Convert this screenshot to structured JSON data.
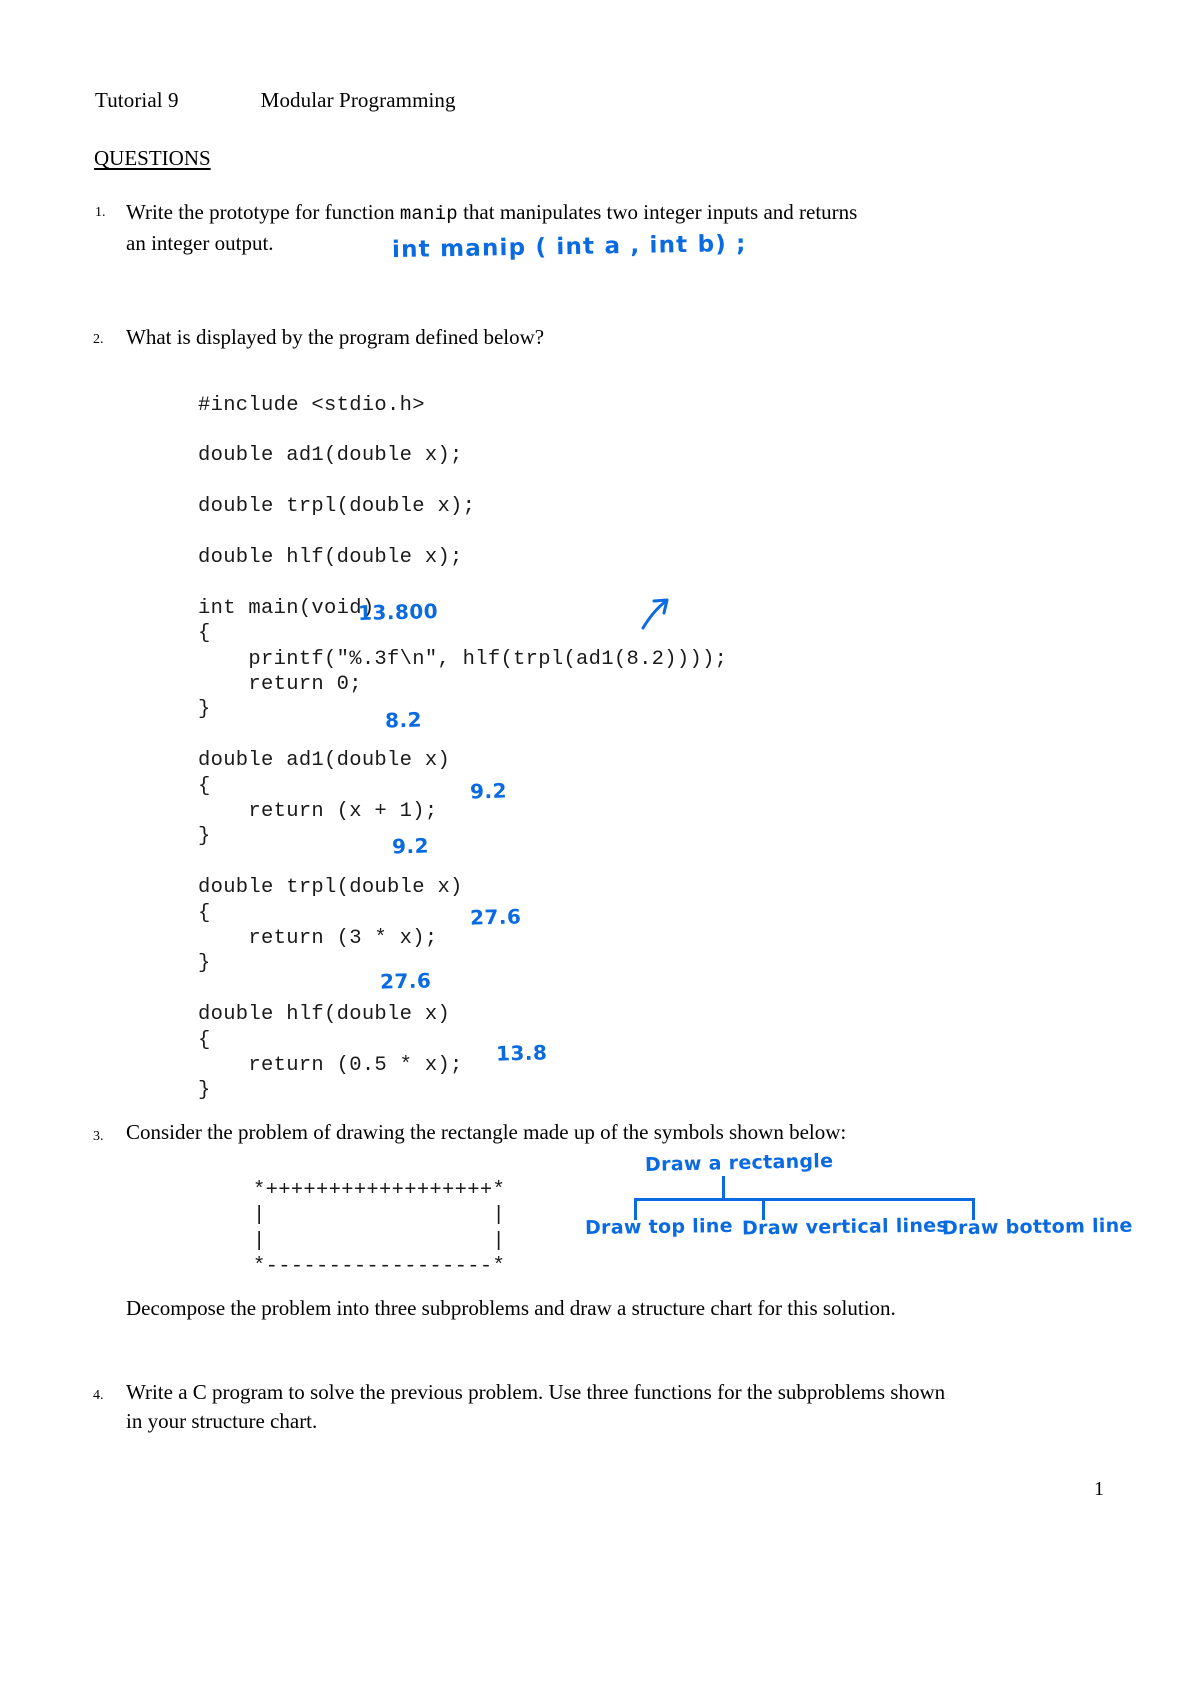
{
  "header": {
    "tutorial": "Tutorial 9",
    "title": "Modular Programming",
    "questions_heading": "QUESTIONS"
  },
  "questions": [
    {
      "number": "1.",
      "line1_pre": "Write the prototype for function ",
      "line1_mono": "manip",
      "line1_post": " that manipulates two integer  inputs and returns",
      "line2": "an integer output."
    },
    {
      "number": "2.",
      "line1": "What is displayed by the program defined below?"
    },
    {
      "number": "3.",
      "line1": "Consider the problem of drawing the rectangle made up of the symbols shown below:",
      "followup": "Decompose the problem into three subproblems and draw a structure chart for this solution."
    },
    {
      "number": "4.",
      "line1": "Write a C program to solve the previous problem.  Use three functions for the subproblems shown",
      "line2": "in your structure chart."
    }
  ],
  "code": {
    "lines": [
      "#include <stdio.h>",
      "",
      "double ad1(double x);",
      "",
      "double trpl(double x);",
      "",
      "double hlf(double x);",
      "",
      "int main(void)",
      "{",
      "    printf(\"%.3f\\n\", hlf(trpl(ad1(8.2))));",
      "    return 0;",
      "}",
      "",
      "double ad1(double x)",
      "{",
      "    return (x + 1);",
      "}",
      "",
      "double trpl(double x)",
      "{",
      "    return (3 * x);",
      "}",
      "",
      "double hlf(double x)",
      "{",
      "    return (0.5 * x);",
      "}"
    ]
  },
  "ascii_rectangle": {
    "lines": [
      "*++++++++++++++++++*",
      "|                  |",
      "|                  |",
      "*------------------*"
    ]
  },
  "annotations": {
    "ink_color": "#0a6ae1",
    "prototype_answer": "int manip ( int a , int b) ;",
    "printf_result": "13.800",
    "ad1_arg": "8.2",
    "ad1_return": "9.2",
    "trpl_arg": "9.2",
    "trpl_return": "27.6",
    "hlf_arg": "27.6",
    "hlf_return": "13.8",
    "arrow": "arrow-up-right"
  },
  "structure_chart": {
    "root": "Draw  a  rectangle",
    "children": [
      "Draw top line",
      "Draw vertical lines",
      "Draw bottom line"
    ]
  },
  "footer": {
    "page_number": "1"
  }
}
